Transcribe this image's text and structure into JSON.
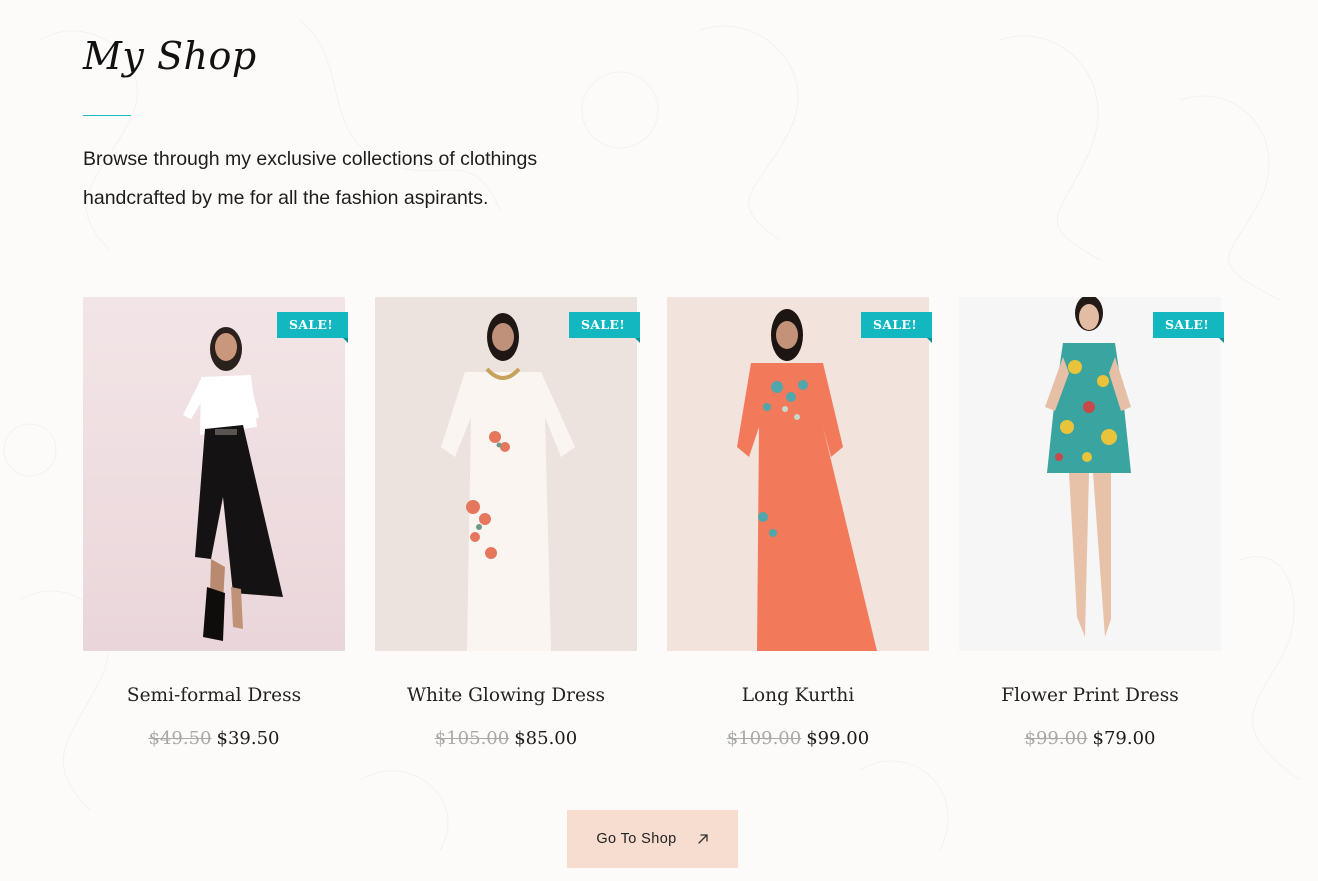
{
  "section": {
    "title": "My Shop",
    "intro_line1": "Browse through my exclusive collections of clothings",
    "intro_line2": "handcrafted by me for all the fashion aspirants."
  },
  "colors": {
    "accent": "#13b7bf",
    "cta_bg": "#f6ddd0",
    "page_bg": "#fdfbf9"
  },
  "products": [
    {
      "name": "Semi-formal Dress",
      "badge": "SALE!",
      "old_price": "$49.50",
      "price": "$39.50",
      "image_icon": "woman-black-skirt-photo"
    },
    {
      "name": "White Glowing Dress",
      "badge": "SALE!",
      "old_price": "$105.00",
      "price": "$85.00",
      "image_icon": "woman-white-kaftan-photo"
    },
    {
      "name": "Long Kurthi",
      "badge": "SALE!",
      "old_price": "$109.00",
      "price": "$99.00",
      "image_icon": "woman-orange-kaftan-photo"
    },
    {
      "name": "Flower Print Dress",
      "badge": "SALE!",
      "old_price": "$99.00",
      "price": "$79.00",
      "image_icon": "woman-floral-mini-dress-photo"
    }
  ],
  "cta": {
    "label": "Go To Shop",
    "icon": "arrow-up-right-icon"
  }
}
